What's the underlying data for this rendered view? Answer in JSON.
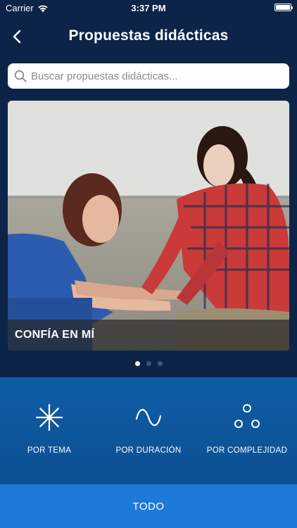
{
  "status_bar": {
    "carrier": "Carrier",
    "time": "3:37 PM"
  },
  "nav": {
    "title": "Propuestas didácticas"
  },
  "search": {
    "placeholder": "Buscar propuestas didácticas..."
  },
  "carousel": {
    "current_caption": "CONFÍA EN MÍ",
    "page_count": 3,
    "active_page": 1
  },
  "filters": [
    {
      "label": "POR TEMA",
      "icon": "asterisk-icon"
    },
    {
      "label": "POR DURACIÓN",
      "icon": "wave-icon"
    },
    {
      "label": "POR COMPLEJIDAD",
      "icon": "three-circles-icon"
    }
  ],
  "footer": {
    "button_label": "TODO"
  },
  "colors": {
    "background": "#0c2448",
    "filters_bg": "#0f5ea6",
    "footer_bg": "#1d7ad8"
  }
}
